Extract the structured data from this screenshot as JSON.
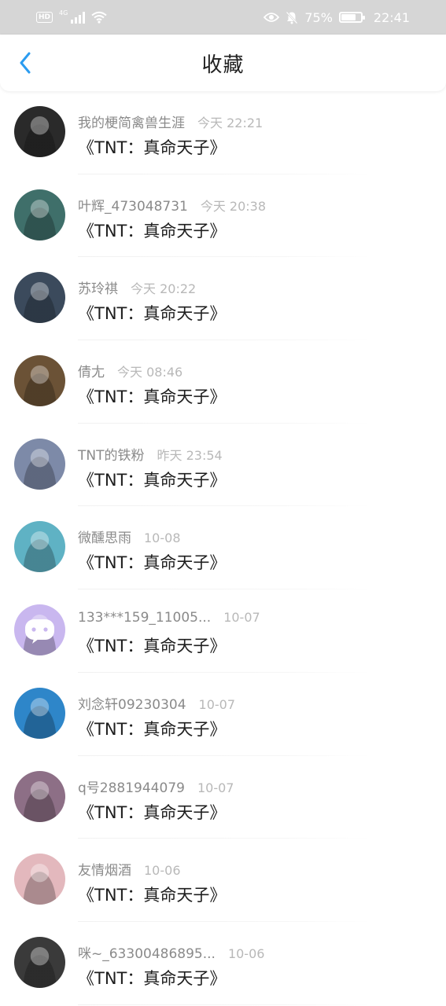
{
  "status_bar": {
    "hd": "HD",
    "network": "4G",
    "battery": "75%",
    "battery_level": 0.75,
    "time": "22:41"
  },
  "nav": {
    "title": "收藏",
    "back_icon": "chevron-left-icon",
    "accent": "#2b9cf0"
  },
  "items": [
    {
      "name": "我的梗简禽兽生涯",
      "time": "今天 22:21",
      "title": "《TNT：真命天子》",
      "avatar_color": "#2a2a2a"
    },
    {
      "name": "叶辉_473048731",
      "time": "今天 20:38",
      "title": "《TNT：真命天子》",
      "avatar_color": "#3f6f6a"
    },
    {
      "name": "苏玲祺",
      "time": "今天 20:22",
      "title": "《TNT：真命天子》",
      "avatar_color": "#3b4a5c"
    },
    {
      "name": "倩尢",
      "time": "今天 08:46",
      "title": "《TNT：真命天子》",
      "avatar_color": "#6b5236"
    },
    {
      "name": "TNT的铁粉",
      "time": "昨天 23:54",
      "title": "《TNT：真命天子》",
      "avatar_color": "#7d8aa8"
    },
    {
      "name": "微醺思雨",
      "time": "10-08",
      "title": "《TNT：真命天子》",
      "avatar_color": "#5fb2c4"
    },
    {
      "name": "133***159_11005...",
      "time": "10-07",
      "title": "《TNT：真命天子》",
      "avatar_color": "#c9b7ef"
    },
    {
      "name": "刘念轩09230304",
      "time": "10-07",
      "title": "《TNT：真命天子》",
      "avatar_color": "#2e86c9"
    },
    {
      "name": "q号2881944079",
      "time": "10-07",
      "title": "《TNT：真命天子》",
      "avatar_color": "#8d6f86"
    },
    {
      "name": "友情烟酒",
      "time": "10-06",
      "title": "《TNT：真命天子》",
      "avatar_color": "#e3b8bd"
    },
    {
      "name": "咪~_63300486895...",
      "time": "10-06",
      "title": "《TNT：真命天子》",
      "avatar_color": "#3a3a3a"
    }
  ]
}
